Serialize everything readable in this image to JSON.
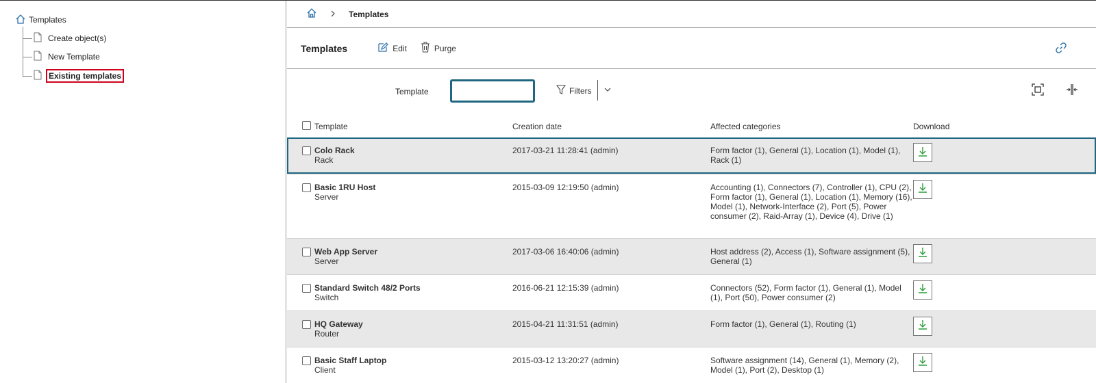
{
  "sidebar": {
    "root_label": "Templates",
    "items": [
      {
        "label": "Create object(s)",
        "selected": false
      },
      {
        "label": "New Template",
        "selected": false
      },
      {
        "label": "Existing templates",
        "selected": true
      }
    ]
  },
  "breadcrumb": {
    "current": "Templates"
  },
  "toolbar": {
    "title": "Templates",
    "edit_label": "Edit",
    "purge_label": "Purge"
  },
  "filter": {
    "label": "Template",
    "value": "",
    "filters_label": "Filters"
  },
  "table": {
    "headers": {
      "template": "Template",
      "creation_date": "Creation date",
      "categories": "Affected categories",
      "download": "Download"
    },
    "rows": [
      {
        "name": "Colo Rack",
        "type": "Rack",
        "date": "2017-03-21 11:28:41 (admin)",
        "categories": "Form factor (1), General (1), Location (1), Model (1), Rack (1)"
      },
      {
        "name": "Basic 1RU Host",
        "type": "Server",
        "date": "2015-03-09 12:19:50 (admin)",
        "categories": "Accounting (1), Connectors (7), Controller (1), CPU (2), Form factor (1), General (1), Location (1), Memory (16), Model (1), Network-Interface (2), Port (5), Power consumer (2), Raid-Array (1), Device (4), Drive (1)"
      },
      {
        "name": "Web App Server",
        "type": "Server",
        "date": "2017-03-06 16:40:06 (admin)",
        "categories": "Host address (2), Access (1), Software assignment (5), General (1)"
      },
      {
        "name": "Standard Switch 48/2 Ports",
        "type": "Switch",
        "date": "2016-06-21 12:15:39 (admin)",
        "categories": "Connectors (52), Form factor (1), General (1), Model (1), Port (50), Power consumer (2)"
      },
      {
        "name": "HQ Gateway",
        "type": "Router",
        "date": "2015-04-21 11:31:51 (admin)",
        "categories": "Form factor (1), General (1), Routing (1)"
      },
      {
        "name": "Basic Staff Laptop",
        "type": "Client",
        "date": "2015-03-12 13:20:27 (admin)",
        "categories": "Software assignment (14), General (1), Memory (2), Model (1), Port (2), Desktop (1)"
      }
    ]
  },
  "icons": {
    "home": "home-icon",
    "chevron": "chevron-right-icon",
    "edit": "edit-icon",
    "purge": "trash-icon",
    "link": "link-icon",
    "filter": "funnel-icon",
    "fit": "fit-screen-icon",
    "columns": "column-resize-icon",
    "download": "download-icon",
    "document": "document-icon"
  },
  "colors": {
    "accent": "#1f6680",
    "selection_border": "#d0021b",
    "download_green": "#2a9d3a",
    "row_shade": "#e8e8e8"
  }
}
